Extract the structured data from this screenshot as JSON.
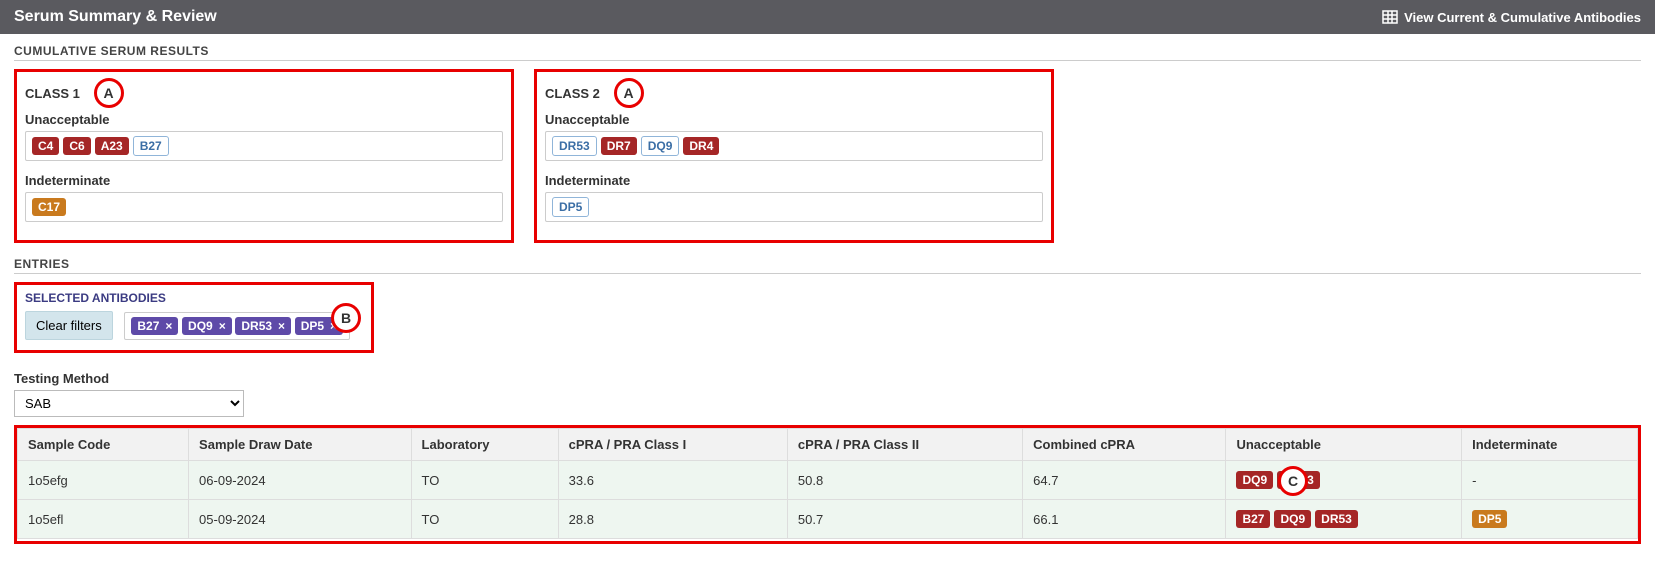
{
  "header": {
    "title": "Serum Summary & Review",
    "view_link": "View Current & Cumulative Antibodies"
  },
  "cumulative": {
    "heading": "CUMULATIVE SERUM RESULTS",
    "class1": {
      "label": "CLASS 1",
      "unacceptable_label": "Unacceptable",
      "unacceptable": [
        {
          "text": "C4",
          "style": "red"
        },
        {
          "text": "C6",
          "style": "red"
        },
        {
          "text": "A23",
          "style": "red"
        },
        {
          "text": "B27",
          "style": "blue"
        }
      ],
      "indeterminate_label": "Indeterminate",
      "indeterminate": [
        {
          "text": "C17",
          "style": "orange"
        }
      ],
      "callout": "A"
    },
    "class2": {
      "label": "CLASS 2",
      "unacceptable_label": "Unacceptable",
      "unacceptable": [
        {
          "text": "DR53",
          "style": "blue"
        },
        {
          "text": "DR7",
          "style": "red"
        },
        {
          "text": "DQ9",
          "style": "blue"
        },
        {
          "text": "DR4",
          "style": "red"
        }
      ],
      "indeterminate_label": "Indeterminate",
      "indeterminate": [
        {
          "text": "DP5",
          "style": "blue"
        }
      ],
      "callout": "A"
    }
  },
  "entries": {
    "heading": "ENTRIES",
    "selected": {
      "heading": "SELECTED ANTIBODIES",
      "clear_label": "Clear filters",
      "chips": [
        "B27",
        "DQ9",
        "DR53",
        "DP5"
      ],
      "callout": "B"
    },
    "testing_method_label": "Testing Method",
    "testing_method_value": "SAB"
  },
  "table": {
    "callout": "C",
    "columns": [
      "Sample Code",
      "Sample Draw Date",
      "Laboratory",
      "cPRA / PRA Class I",
      "cPRA / PRA Class II",
      "Combined cPRA",
      "Unacceptable",
      "Indeterminate"
    ],
    "rows": [
      {
        "code": "1o5efg",
        "draw": "06-09-2024",
        "lab": "TO",
        "c1": "33.6",
        "c2": "50.8",
        "comb": "64.7",
        "unacceptable": [
          {
            "text": "DQ9",
            "style": "red"
          },
          {
            "text": "DR53",
            "style": "red"
          }
        ],
        "indeterminate_text": "-",
        "indeterminate": []
      },
      {
        "code": "1o5efl",
        "draw": "05-09-2024",
        "lab": "TO",
        "c1": "28.8",
        "c2": "50.7",
        "comb": "66.1",
        "unacceptable": [
          {
            "text": "B27",
            "style": "red"
          },
          {
            "text": "DQ9",
            "style": "red"
          },
          {
            "text": "DR53",
            "style": "red"
          }
        ],
        "indeterminate_text": "",
        "indeterminate": [
          {
            "text": "DP5",
            "style": "orange"
          }
        ]
      }
    ]
  }
}
